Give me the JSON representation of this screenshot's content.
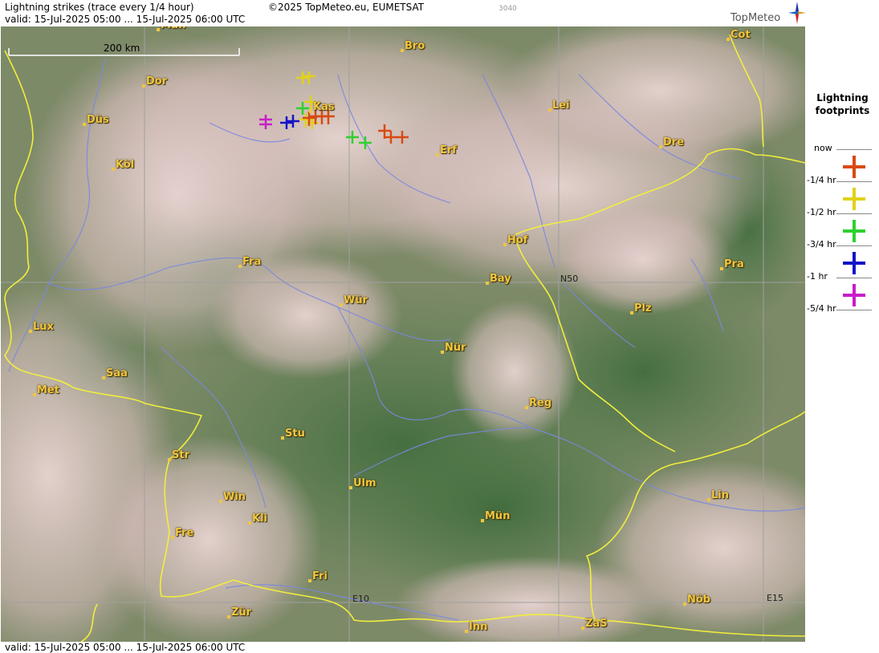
{
  "header": {
    "title": "Lightning strikes (trace every 1/4 hour)",
    "copyright": "©2025 TopMeteo.eu, EUMETSAT",
    "code": "3040",
    "valid": "valid:  15-Jul-2025 05:00 ... 15-Jul-2025 06:00 UTC",
    "logo_text": "TopMeteo"
  },
  "footer": {
    "valid": "valid:  15-Jul-2025 05:00 ... 15-Jul-2025 06:00 UTC"
  },
  "map": {
    "scale_label": "200 km",
    "grid_labels": {
      "lat": "N50",
      "lon1": "E10",
      "lon2": "E15"
    },
    "cities": [
      {
        "name": "Mün",
        "key": "mun-top"
      },
      {
        "name": "Bro",
        "key": "bro"
      },
      {
        "name": "Cot",
        "key": "cot"
      },
      {
        "name": "Dor",
        "key": "dor"
      },
      {
        "name": "Düs",
        "key": "dus"
      },
      {
        "name": "Kas",
        "key": "kas"
      },
      {
        "name": "Lei",
        "key": "lei"
      },
      {
        "name": "Köl",
        "key": "kol"
      },
      {
        "name": "Erf",
        "key": "erf"
      },
      {
        "name": "Dre",
        "key": "dre"
      },
      {
        "name": "Fra",
        "key": "fra"
      },
      {
        "name": "Hof",
        "key": "hof"
      },
      {
        "name": "Pra",
        "key": "pra"
      },
      {
        "name": "Bay",
        "key": "bay"
      },
      {
        "name": "Würz",
        "key": "wur",
        "display": "Wür"
      },
      {
        "name": "Plz",
        "key": "plz"
      },
      {
        "name": "Lux",
        "key": "lux"
      },
      {
        "name": "Nür",
        "key": "nur"
      },
      {
        "name": "Saa",
        "key": "saa"
      },
      {
        "name": "Met",
        "key": "met"
      },
      {
        "name": "Reg",
        "key": "reg"
      },
      {
        "name": "Stu",
        "key": "stu"
      },
      {
        "name": "Str",
        "key": "str"
      },
      {
        "name": "Ulm",
        "key": "ulm"
      },
      {
        "name": "Lin",
        "key": "lin"
      },
      {
        "name": "Win",
        "key": "win"
      },
      {
        "name": "Kli",
        "key": "kli"
      },
      {
        "name": "Mün",
        "key": "mun"
      },
      {
        "name": "Fre",
        "key": "fre"
      },
      {
        "name": "Fri",
        "key": "fri"
      },
      {
        "name": "Nöb",
        "key": "nob"
      },
      {
        "name": "Zür",
        "key": "zur"
      },
      {
        "name": "Inn",
        "key": "inn"
      },
      {
        "name": "ZaS",
        "key": "zas"
      }
    ]
  },
  "legend": {
    "title_line1": "Lightning",
    "title_line2": "footprints",
    "items": [
      {
        "label": "now",
        "color": "#d94a12"
      },
      {
        "label": "-1/4 hr",
        "color": "#e0d21a"
      },
      {
        "label": "-1/2 hr",
        "color": "#2fd02f"
      },
      {
        "label": "-3/4 hr",
        "color": "#1414c8"
      },
      {
        "label": "-1 hr",
        "color": "#c81ec8"
      },
      {
        "label": "-5/4 hr",
        "color": ""
      }
    ]
  },
  "colors": {
    "border": "#f2ee3c",
    "rivers": "#7b88e0",
    "grid": "#a0a0a0",
    "city_label": "#f0c640"
  }
}
